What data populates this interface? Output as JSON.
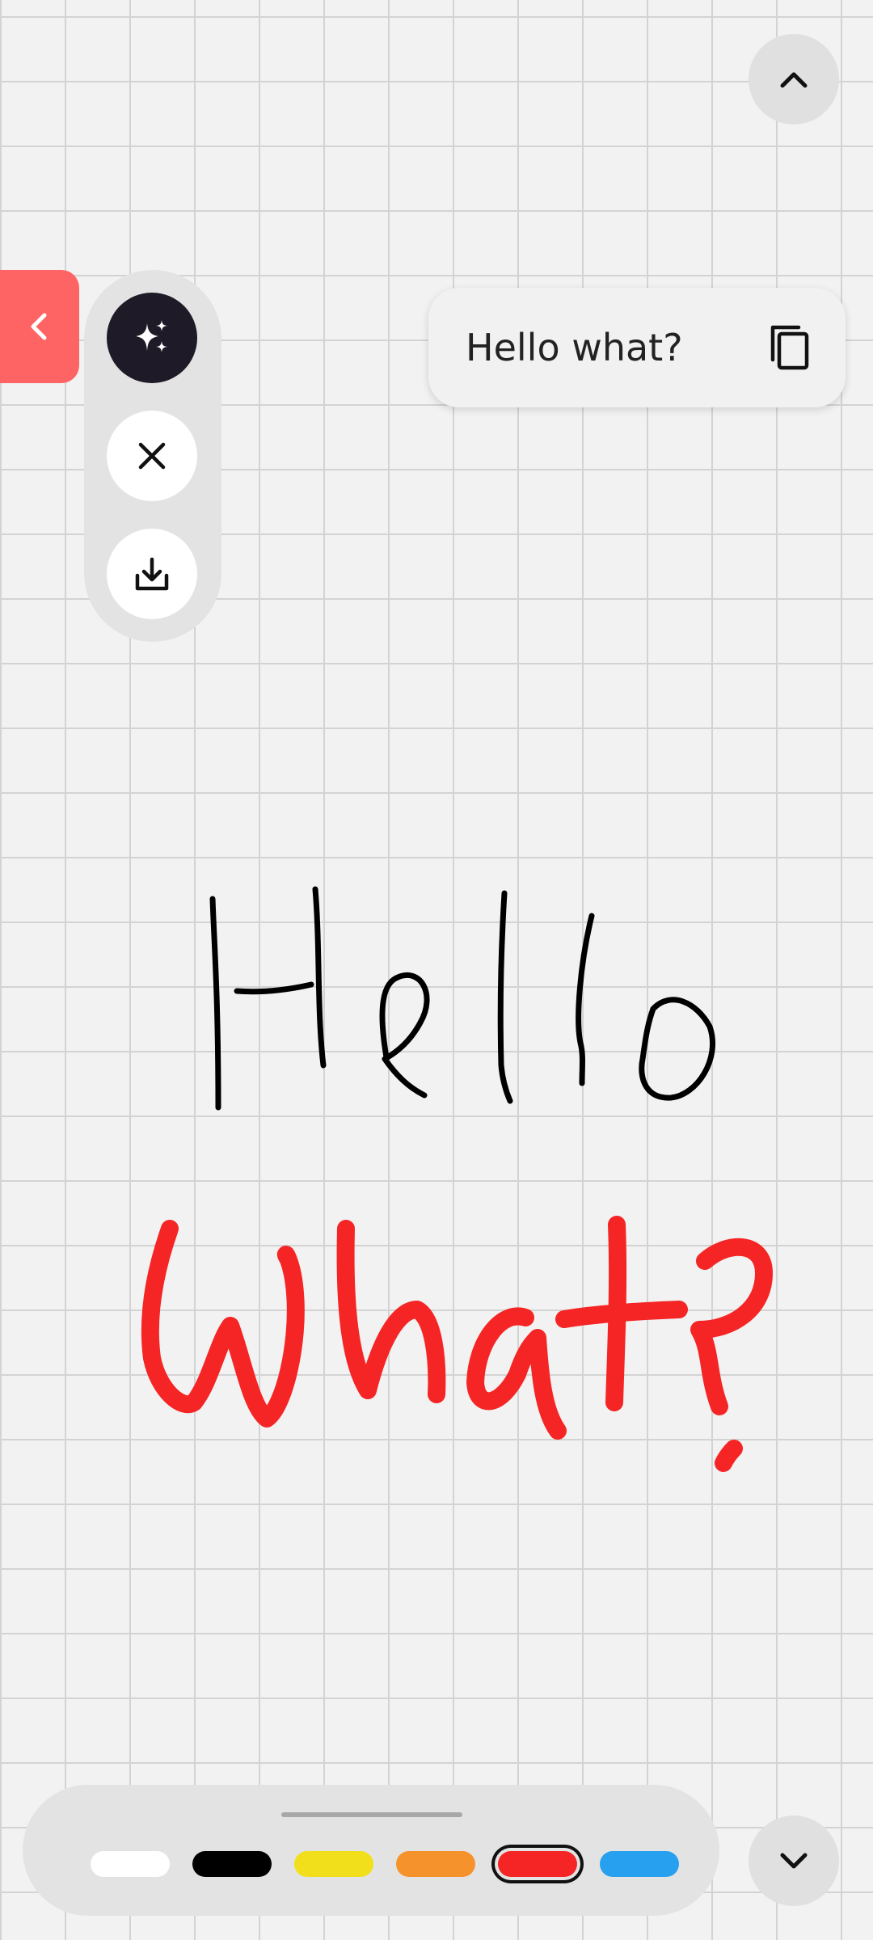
{
  "toolbar": {
    "collapse_icon": "chevron-left-icon",
    "collapse_color": "#ff6464",
    "tools": [
      {
        "name": "ai-recognize",
        "icon": "sparkles-icon"
      },
      {
        "name": "clear",
        "icon": "close-icon"
      },
      {
        "name": "download",
        "icon": "download-icon"
      }
    ]
  },
  "recognition": {
    "text": "Hello what?",
    "copy_icon": "copy-icon"
  },
  "nav": {
    "scroll_up_icon": "chevron-up-icon",
    "scroll_down_icon": "chevron-down-icon"
  },
  "palette": {
    "colors": [
      "#ffffff",
      "#000000",
      "#f2df1b",
      "#f6922c",
      "#f52525",
      "#27a0ef"
    ],
    "color_names": [
      "white",
      "black",
      "yellow",
      "orange",
      "red",
      "blue"
    ],
    "selected": "red"
  },
  "drawing": {
    "ink_colors": [
      "#000000",
      "#f52525"
    ]
  }
}
